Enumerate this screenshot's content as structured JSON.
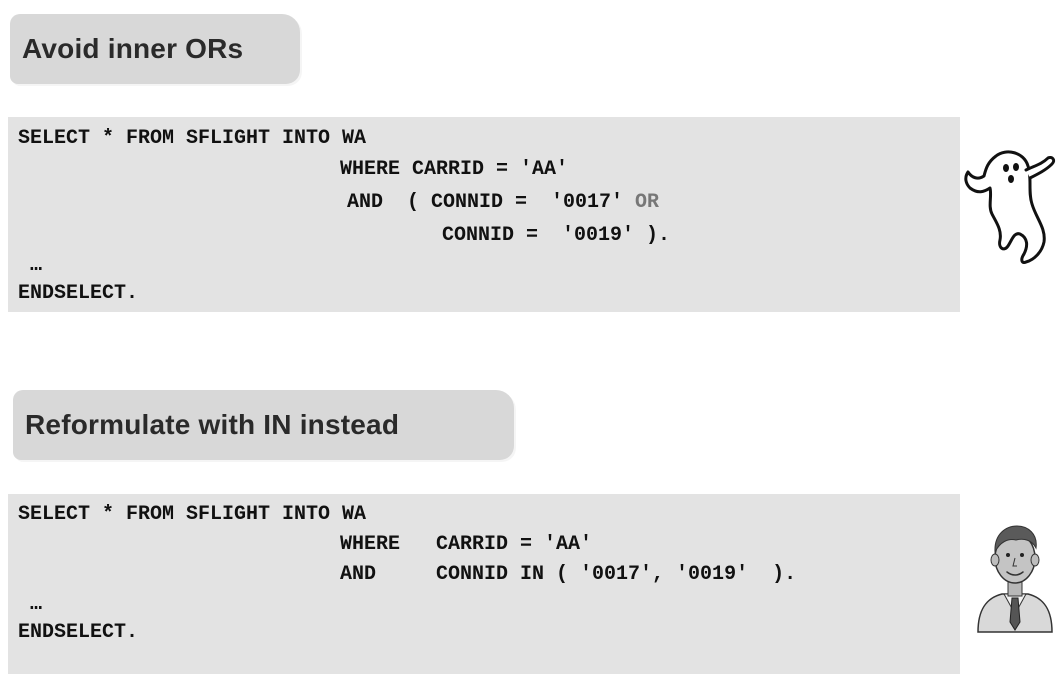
{
  "section_1": {
    "heading": "Avoid inner ORs",
    "code": {
      "line_1": "SELECT * FROM SFLIGHT INTO WA",
      "line_2": "WHERE CARRID = 'AA'",
      "line_3_main": "AND  ( CONNID =  '0017' ",
      "line_3_or": "OR",
      "line_4": "CONNID =  '0019' ).",
      "line_5": "…",
      "line_6": "ENDSELECT."
    },
    "clipart": "ghost-icon"
  },
  "section_2": {
    "heading": "Reformulate with IN instead",
    "code": {
      "line_1": "SELECT * FROM SFLIGHT INTO WA",
      "line_2": "WHERE   CARRID = 'AA'",
      "line_3": "AND     CONNID IN ( '0017', '0019'  ).",
      "line_4": "…",
      "line_5": "ENDSELECT."
    },
    "clipart": "businessman-icon"
  },
  "colors": {
    "banner": "#d8d8d8",
    "code_background": "#e3e3e3",
    "or_keyword": "#777777"
  }
}
